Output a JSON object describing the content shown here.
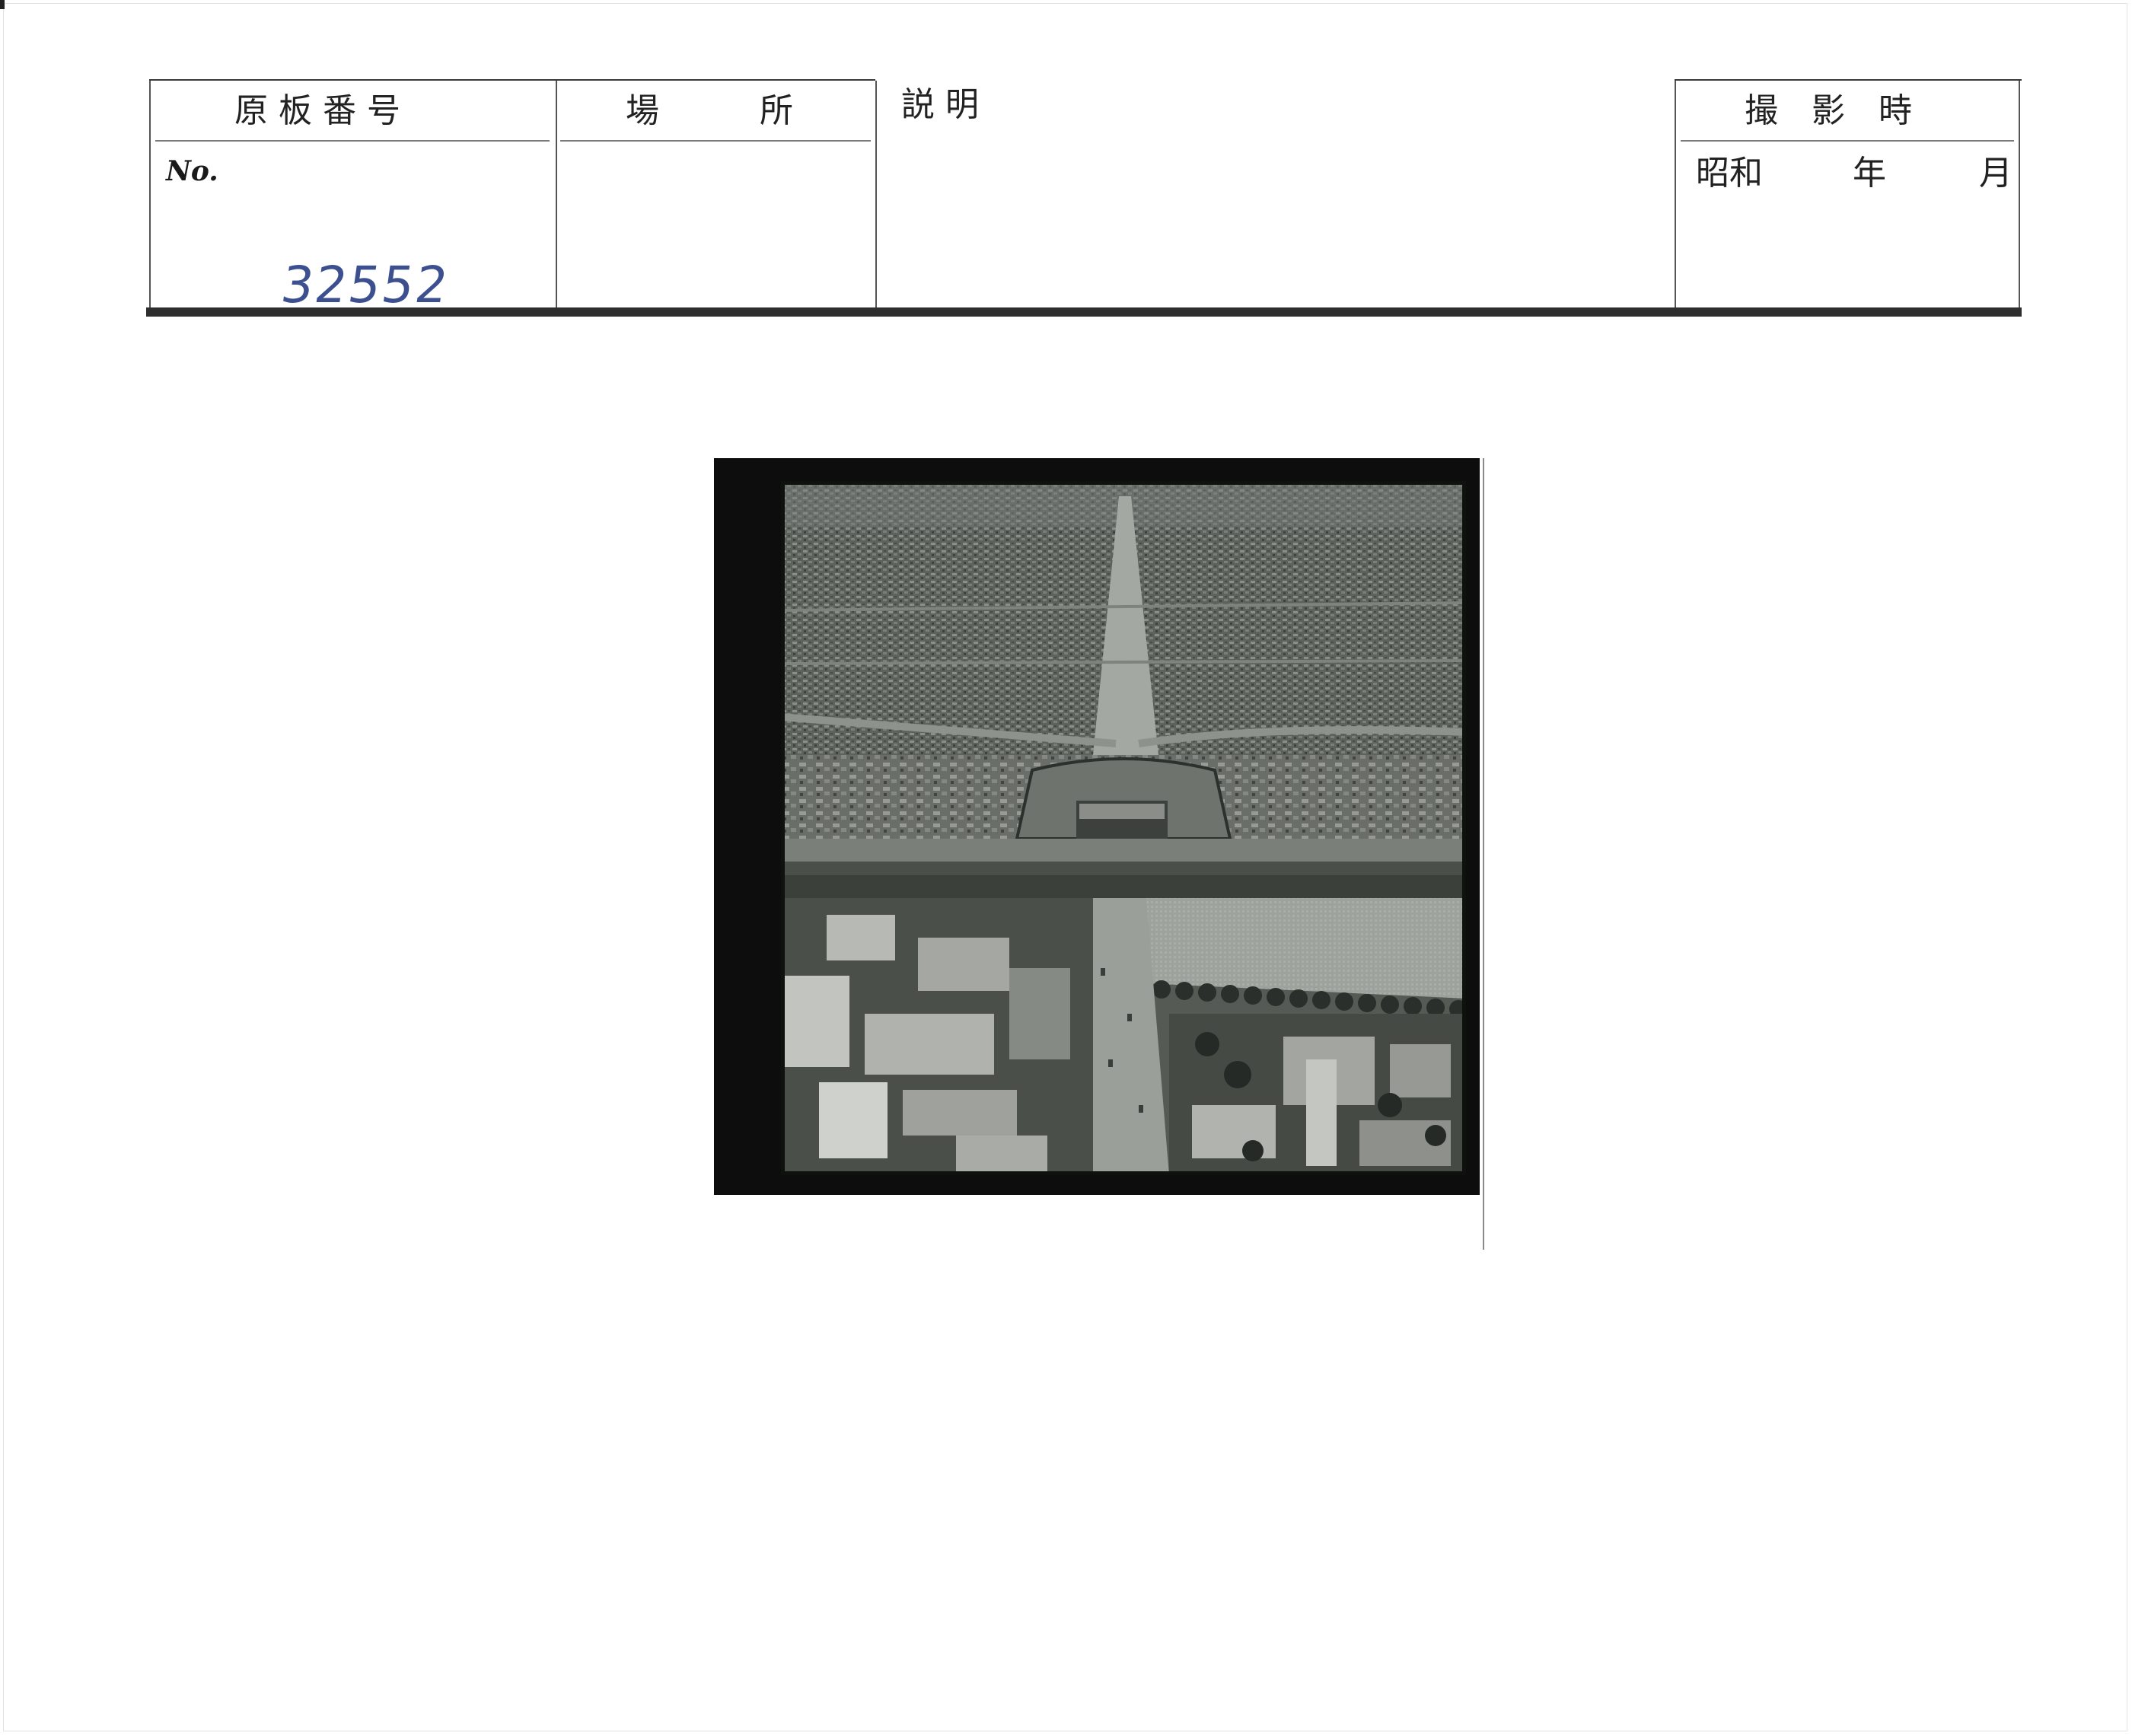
{
  "header": {
    "plate_number_label": "原 板 番 号",
    "location_label": "場　　　所",
    "description_label": "説 明",
    "shooting_time_label": "撮　影　時",
    "era_label": "昭和",
    "year_label": "年",
    "month_label": "月",
    "no_label": "No.",
    "plate_number_handwritten": "32552"
  },
  "photo": {
    "subject": "aerial view of walled city with city gate, straight avenue and dense rooftops",
    "tone": "black and white"
  }
}
